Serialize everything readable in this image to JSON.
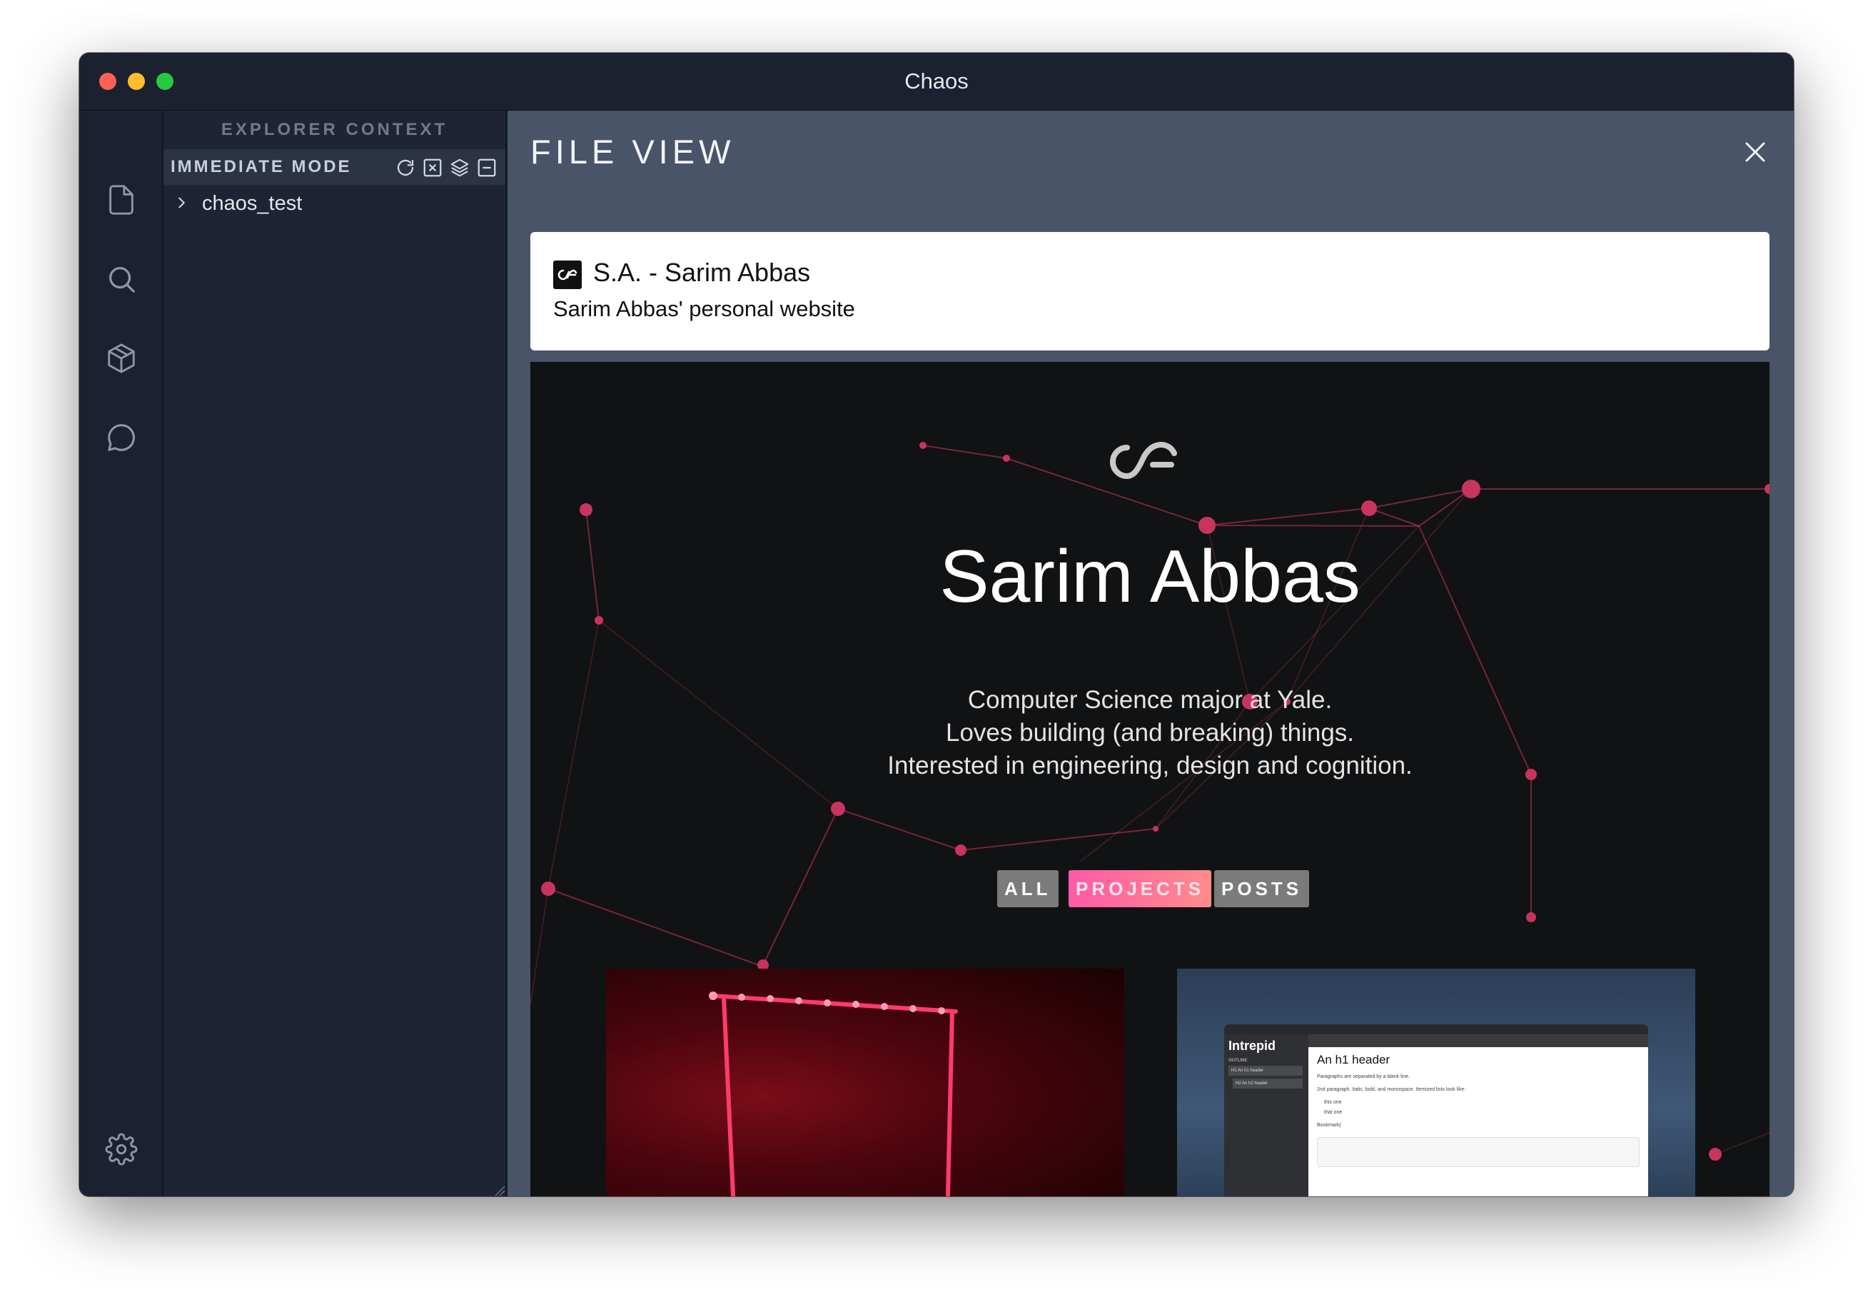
{
  "window": {
    "title": "Chaos"
  },
  "activity_bar": {
    "items": [
      {
        "icon": "file-icon"
      },
      {
        "icon": "search-icon"
      },
      {
        "icon": "package-icon"
      },
      {
        "icon": "chat-icon"
      }
    ],
    "bottom_icon": "settings-gear-icon"
  },
  "sidebar": {
    "header": "EXPLORER CONTEXT",
    "section_title": "IMMEDIATE MODE",
    "actions": [
      "refresh-icon",
      "clear-icon",
      "layers-icon",
      "collapse-icon"
    ],
    "tree": [
      {
        "label": "chaos_test",
        "expanded": false
      }
    ]
  },
  "main": {
    "title": "FILE VIEW",
    "link_preview": {
      "site_title": "S.A. - Sarim Abbas",
      "description": "Sarim Abbas' personal website"
    },
    "website": {
      "name": "Sarim Abbas",
      "bio_lines": [
        "Computer Science major at Yale.",
        "Loves building (and breaking) things.",
        "Interested in engineering, design and cognition."
      ],
      "filters": [
        {
          "label": "ALL",
          "active": false
        },
        {
          "label": "PROJECTS",
          "active": true
        },
        {
          "label": "POSTS",
          "active": false
        }
      ],
      "thumbnail_right": {
        "app_name": "Intrepid",
        "sidebar_heading": "OUTLINE",
        "outline_items": [
          "H1 An h1 header",
          "H2 An h2 header"
        ],
        "doc_heading": "An h1 header",
        "doc_line1": "Paragraphs are separated by a blank line.",
        "doc_line2": "2nd paragraph. Italic, bold, and monospace. Itemized lists look like:",
        "list_items": [
          "this one",
          "that one"
        ],
        "bookmark_label": "Bookmark|"
      }
    }
  },
  "colors": {
    "accent_pink": "#ff6fa3",
    "network_node": "#c9345e",
    "panel_bg": "#4a5468"
  }
}
